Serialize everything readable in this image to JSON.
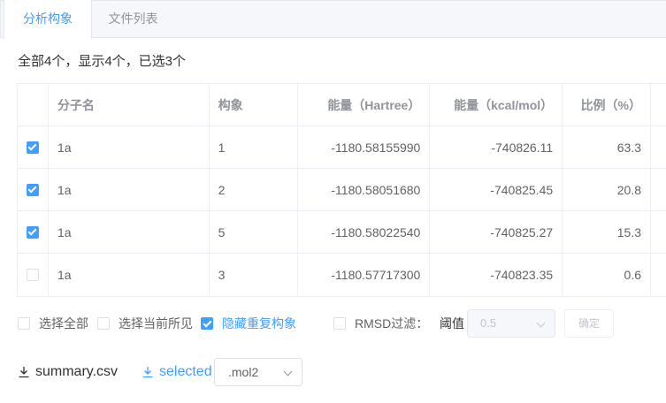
{
  "tabs": [
    {
      "label": "分析构象",
      "active": true
    },
    {
      "label": "文件列表",
      "active": false
    }
  ],
  "summary": "全部4个，显示4个，已选3个",
  "table": {
    "headers": [
      "分子名",
      "构象",
      "能量（Hartree）",
      "能量（kcal/mol）",
      "比例（%）"
    ],
    "rows": [
      {
        "checked": true,
        "name": "1a",
        "conf": "1",
        "hartree": "-1180.58155990",
        "kcal": "-740826.11",
        "ratio": "63.3"
      },
      {
        "checked": true,
        "name": "1a",
        "conf": "2",
        "hartree": "-1180.58051680",
        "kcal": "-740825.45",
        "ratio": "20.8"
      },
      {
        "checked": true,
        "name": "1a",
        "conf": "5",
        "hartree": "-1180.58022540",
        "kcal": "-740825.27",
        "ratio": "15.3"
      },
      {
        "checked": false,
        "name": "1a",
        "conf": "3",
        "hartree": "-1180.57717300",
        "kcal": "-740823.35",
        "ratio": "0.6"
      }
    ]
  },
  "options": {
    "select_all": "选择全部",
    "select_visible": "选择当前所见",
    "hide_duplicates": "隐藏重复构象",
    "rmsd_filter": "RMSD过滤：",
    "threshold_label": "阈值",
    "threshold_value": "0.5",
    "confirm": "确定"
  },
  "downloads": {
    "summary": "summary.csv",
    "selected": "selected",
    "format": ".mol2"
  },
  "colors": {
    "accent": "#409eff",
    "border": "#ebeef5",
    "text": "#606266"
  }
}
